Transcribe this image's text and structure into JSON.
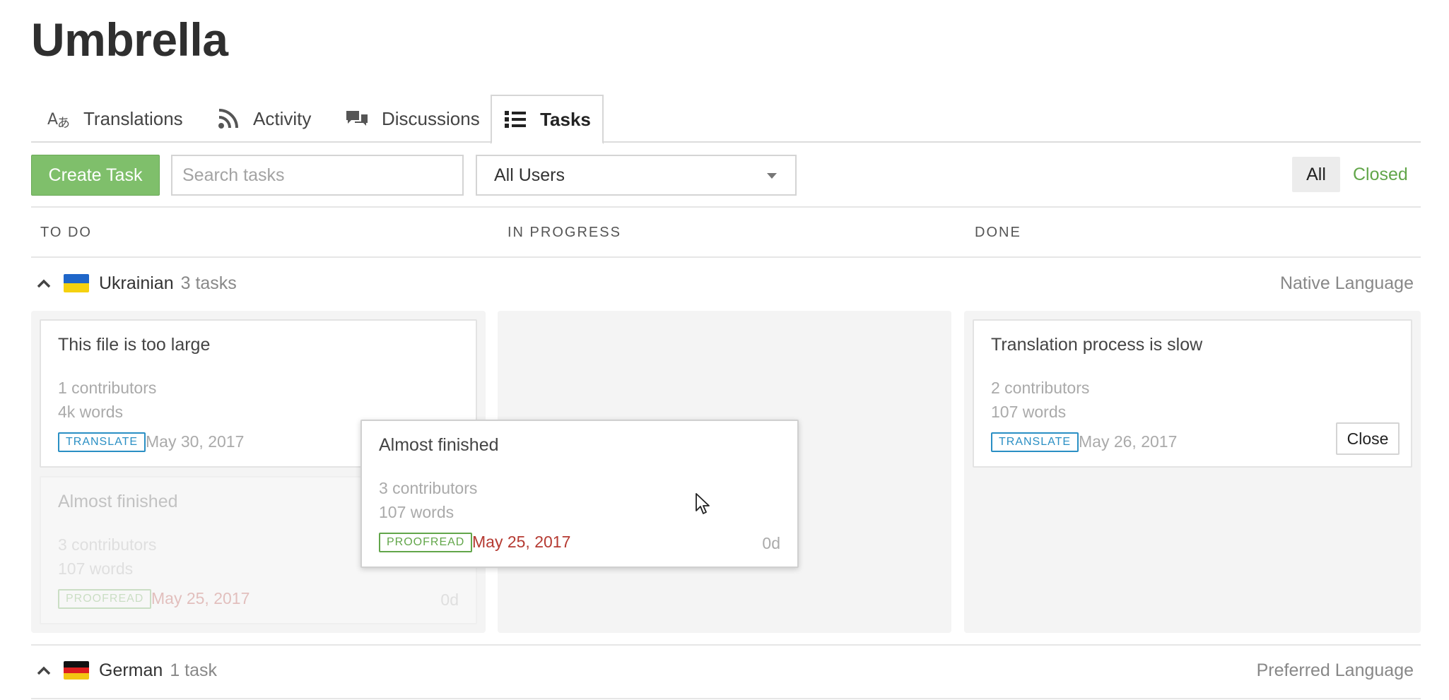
{
  "project": {
    "title": "Umbrella"
  },
  "tabs": [
    {
      "label": "Translations",
      "icon": "translate-icon"
    },
    {
      "label": "Activity",
      "icon": "rss-icon"
    },
    {
      "label": "Discussions",
      "icon": "comments-icon"
    },
    {
      "label": "Tasks",
      "icon": "list-icon",
      "active": true
    }
  ],
  "toolbar": {
    "create_label": "Create Task",
    "search_placeholder": "Search tasks",
    "users_select": "All Users",
    "filter_all": "All",
    "filter_closed": "Closed"
  },
  "columns": [
    "TO DO",
    "IN PROGRESS",
    "DONE"
  ],
  "groups": [
    {
      "language": "Ukrainian",
      "count": "3 tasks",
      "preference": "Native Language",
      "flag_colors": [
        "#1f66c9",
        "#f5d10f"
      ],
      "todo": [
        {
          "title": "This file is too large",
          "contributors": "1 contributors",
          "words": "4k words",
          "type": "TRANSLATE",
          "date": "May 30, 2017"
        },
        {
          "title": "Almost finished",
          "contributors": "3 contributors",
          "words": "107 words",
          "type": "PROOFREAD",
          "date": "May 25, 2017",
          "due": "0d"
        }
      ],
      "done": [
        {
          "title": "Translation process is slow",
          "contributors": "2 contributors",
          "words": "107 words",
          "type": "TRANSLATE",
          "date": "May 26, 2017",
          "action": "Close"
        }
      ]
    },
    {
      "language": "German",
      "count": "1 task",
      "preference": "Preferred Language",
      "flag_colors": [
        "#111111",
        "#dd1f1f",
        "#f3c612"
      ]
    }
  ],
  "dragging_card": {
    "title": "Almost finished",
    "contributors": "3 contributors",
    "words": "107 words",
    "type": "PROOFREAD",
    "date": "May 25, 2017",
    "due": "0d"
  },
  "colors": {
    "accent_green": "#7fbf6b",
    "link_green": "#62a64a",
    "translate_blue": "#2a8fc4",
    "overdue_red": "#b53a32"
  }
}
